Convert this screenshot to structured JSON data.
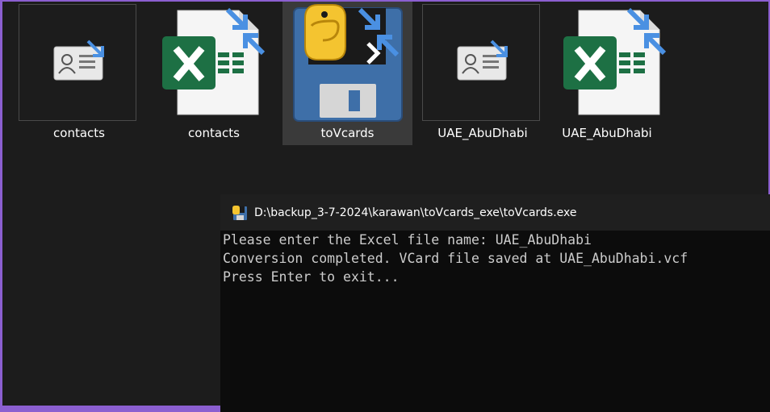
{
  "files": [
    {
      "label": "contacts",
      "type": "contact-file-icon",
      "selected": false
    },
    {
      "label": "contacts",
      "type": "excel-file-icon",
      "selected": false
    },
    {
      "label": "toVcards",
      "type": "python-exe-icon",
      "selected": true
    },
    {
      "label": "UAE_AbuDhabi",
      "type": "contact-file-icon",
      "selected": false
    },
    {
      "label": "UAE_AbuDhabi",
      "type": "excel-file-icon",
      "selected": false
    }
  ],
  "console": {
    "title": "D:\\backup_3-7-2024\\karawan\\toVcards_exe\\toVcards.exe",
    "lines": [
      "Please enter the Excel file name: UAE_AbuDhabi",
      "Conversion completed. VCard file saved at UAE_AbuDhabi.vcf",
      "Press Enter to exit..."
    ]
  },
  "colors": {
    "excel_green": "#1d7044",
    "shortcut_blue": "#4a90e2",
    "floppy_blue": "#3e6fa8",
    "python_yellow": "#f4c430"
  }
}
